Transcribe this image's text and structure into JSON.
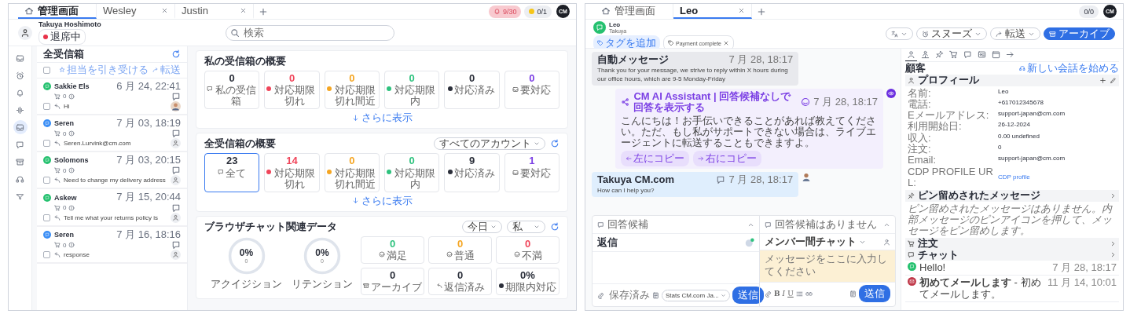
{
  "left_window": {
    "tabs": [
      {
        "kind": "home",
        "label": "管理画面",
        "selected": true,
        "closable": false
      },
      {
        "kind": "contact",
        "label": "Wesley",
        "selected": false,
        "closable": true
      },
      {
        "kind": "contact",
        "label": "Justin",
        "selected": false,
        "closable": true
      }
    ],
    "notification_count": "9/30",
    "coin_count": "0/1",
    "avatar": "CM",
    "user": {
      "name": "Takuya Hoshimoto",
      "status": "退席中"
    },
    "search": {
      "placeholder": "検索"
    },
    "nav": [
      {
        "kind": "inbox",
        "selected": false
      },
      {
        "kind": "alarm",
        "selected": false
      },
      {
        "kind": "bell",
        "selected": false
      },
      {
        "kind": "wave",
        "selected": false
      },
      {
        "kind": "inbox",
        "selected": true
      },
      {
        "kind": "chat",
        "selected": false
      },
      {
        "kind": "archive",
        "selected": false
      },
      {
        "kind": "headset",
        "selected": false
      },
      {
        "kind": "filter",
        "selected": false
      }
    ],
    "inbox": {
      "title": "全受信箱",
      "select_all": {
        "checked": false
      },
      "actions": [
        {
          "kind": "assign",
          "label": "担当を引き受ける"
        },
        {
          "kind": "forward",
          "label": "転送"
        }
      ],
      "conversations": [
        {
          "kind": "whatsapp",
          "name": "Sakkie Els",
          "time": "6 月 24, 22:41",
          "cart": "0",
          "preview": "Hi",
          "checked": false,
          "photo_avatar": true
        },
        {
          "kind": "webchat",
          "name": "Seren",
          "time": "7 月 03, 18:19",
          "cart": "0",
          "preview": "Seren.Lurvink@cm.com",
          "checked": false,
          "photo_avatar": false
        },
        {
          "kind": "whatsapp",
          "name": "Solomons",
          "time": "7 月 03, 20:15",
          "cart": "0",
          "preview": "Need to change my delivery address",
          "checked": false,
          "photo_avatar": false
        },
        {
          "kind": "whatsapp",
          "name": "Askew",
          "time": "7 月 15, 20:44",
          "cart": "0",
          "preview": "Tell me what your returns policy is",
          "checked": false,
          "photo_avatar": false
        },
        {
          "kind": "webchat",
          "name": "Seren",
          "time": "7 月 16, 18:16",
          "cart": "0",
          "preview": "response",
          "checked": false,
          "photo_avatar": false
        }
      ]
    },
    "my_inbox": {
      "title": "私の受信箱の概要",
      "more": "さらに表示",
      "stats": [
        {
          "kind": "inbox",
          "value": "0",
          "label": "私の受信箱",
          "selected": false
        },
        {
          "kind": "overdue",
          "value": "0",
          "label": "対応期限切れ",
          "selected": false
        },
        {
          "kind": "due_soon",
          "value": "0",
          "label": "対応期限切れ間近",
          "selected": false
        },
        {
          "kind": "in_time",
          "value": "0",
          "label": "対応期限内",
          "selected": false
        },
        {
          "kind": "done",
          "value": "0",
          "label": "対応済み",
          "selected": false
        },
        {
          "kind": "action",
          "value": "0",
          "label": "要対応",
          "selected": false
        }
      ]
    },
    "all_inbox": {
      "title": "全受信箱の概要",
      "account_filter": "すべてのアカウント",
      "more": "さらに表示",
      "stats": [
        {
          "kind": "inbox",
          "value": "23",
          "label": "全て",
          "selected": true
        },
        {
          "kind": "overdue",
          "value": "14",
          "label": "対応期限切れ",
          "selected": false
        },
        {
          "kind": "due_soon",
          "value": "0",
          "label": "対応期限切れ間近",
          "selected": false
        },
        {
          "kind": "in_time",
          "value": "0",
          "label": "対応期限内",
          "selected": false
        },
        {
          "kind": "done",
          "value": "9",
          "label": "対応済み",
          "selected": false
        },
        {
          "kind": "action",
          "value": "1",
          "label": "要対応",
          "selected": false
        }
      ]
    },
    "browser_chat": {
      "title": "ブラウザチャット関連データ",
      "period_filter": "今日",
      "owner_filter": "私",
      "rings": [
        {
          "value": "0%",
          "count": "0",
          "label": "アクイジション",
          "level": 0
        },
        {
          "value": "0%",
          "count": "0",
          "label": "リテンション",
          "level": 0
        }
      ],
      "stats": [
        {
          "kind": "satisfied",
          "value": "0",
          "label": "満足"
        },
        {
          "kind": "neutral",
          "value": "0",
          "label": "普通"
        },
        {
          "kind": "unsatisfied",
          "value": "0",
          "label": "不満"
        },
        {
          "kind": "archive",
          "value": "0",
          "label": "アーカイブ"
        },
        {
          "kind": "replied",
          "value": "0",
          "label": "返信済み"
        },
        {
          "kind": "done",
          "value": "0%",
          "label": "期限内対応"
        }
      ]
    }
  },
  "right_window": {
    "tabs": [
      {
        "kind": "home",
        "label": "管理画面",
        "selected": false,
        "closable": false
      },
      {
        "kind": "contact",
        "label": "Leo",
        "selected": true,
        "closable": true
      }
    ],
    "counter": "0/0",
    "avatar": "CM",
    "contact": {
      "name": "Leo",
      "subtitle": "Takuya",
      "add_tag": "タグを追加",
      "tags": [
        "Payment complete"
      ]
    },
    "header_actions": [
      {
        "kind": "translate"
      },
      {
        "kind": "snooze",
        "label": "スヌーズ"
      },
      {
        "kind": "forward",
        "label": "転送"
      },
      {
        "kind": "archive",
        "label": "アーカイブ"
      }
    ],
    "messages": [
      {
        "kind": "auto",
        "title": "自動メッセージ",
        "time": "7 月 28, 18:17",
        "text": "Thank you for your message, we strive to reply within X hours during our office hours, which are 9-5 Monday-Friday"
      },
      {
        "kind": "ai",
        "title": "CM AI Assistant | 回答候補なしで回答を表示する",
        "time": "7 月 28, 18:17",
        "text": "こんにちは！お手伝いできることがあれば教えてください。ただ、もし私がサポートできない場合は、ライブエージェントに転送することもできますよ。",
        "actions": [
          {
            "kind": "left",
            "label": "左にコピー"
          },
          {
            "kind": "right",
            "label": "右にコピー"
          }
        ]
      },
      {
        "kind": "agent",
        "title": "Takuya CM.com",
        "time": "7 月 28, 18:17",
        "text": "How can I help you?"
      }
    ],
    "composers": [
      {
        "kind": "reply",
        "suggestion": "回答候補",
        "label": "返信",
        "saved": "保存済み",
        "sender": "Stats CM.com Ja...",
        "send": "送信"
      },
      {
        "kind": "internal",
        "suggestion": "回答候補はありません",
        "label": "メンバー間チャット",
        "placeholder": "メッセージをここに入力してください",
        "format": [
          {
            "kind": "bold",
            "label": "B"
          },
          {
            "kind": "italic",
            "label": "I"
          },
          {
            "kind": "underline",
            "label": "U"
          }
        ],
        "send": "送信"
      }
    ],
    "sidebar": {
      "tabs": [
        {
          "kind": "person",
          "selected": true
        },
        {
          "kind": "group",
          "selected": false
        },
        {
          "kind": "pin",
          "selected": false
        },
        {
          "kind": "cart",
          "selected": false
        },
        {
          "kind": "chat",
          "selected": false
        },
        {
          "kind": "idcard",
          "selected": false
        },
        {
          "kind": "calendar",
          "selected": false
        },
        {
          "kind": "more",
          "selected": false
        }
      ],
      "section": "顧客",
      "new_conversation": "新しい会話を始める",
      "profile_title": "プロフィール",
      "fields": [
        {
          "kind": "text",
          "label": "名前:",
          "value": "Leo"
        },
        {
          "kind": "text",
          "label": "電話:",
          "value": "+617012345678"
        },
        {
          "kind": "text",
          "label": "Eメールアドレス:",
          "value": "support-japan@cm.com"
        },
        {
          "kind": "text",
          "label": "利用開始日:",
          "value": "26-12-2024"
        },
        {
          "kind": "text",
          "label": "収入:",
          "value": "0.00 undefined"
        },
        {
          "kind": "text",
          "label": "注文:",
          "value": "0"
        },
        {
          "kind": "text",
          "label": "Email:",
          "value": "support-japan@cm.com"
        },
        {
          "kind": "link",
          "label": "CDP PROFILE URL:",
          "value": "CDP profile"
        }
      ],
      "pinned_title": "ピン留めされたメッセージ",
      "pinned_note": "ピン留めされたメッセージはありません。内部メッセージのピンアイコンを押して、メッセージをピン留めします。",
      "orders_title": "注文",
      "chats_title": "チャット",
      "chats": [
        {
          "kind": "whatsapp",
          "text": "Hello!",
          "time": "7 月 28, 18:17"
        },
        {
          "kind": "email",
          "text": "**初めてメールします** - 初めてメールします。",
          "time": "11 月 14, 10:01"
        }
      ]
    }
  }
}
